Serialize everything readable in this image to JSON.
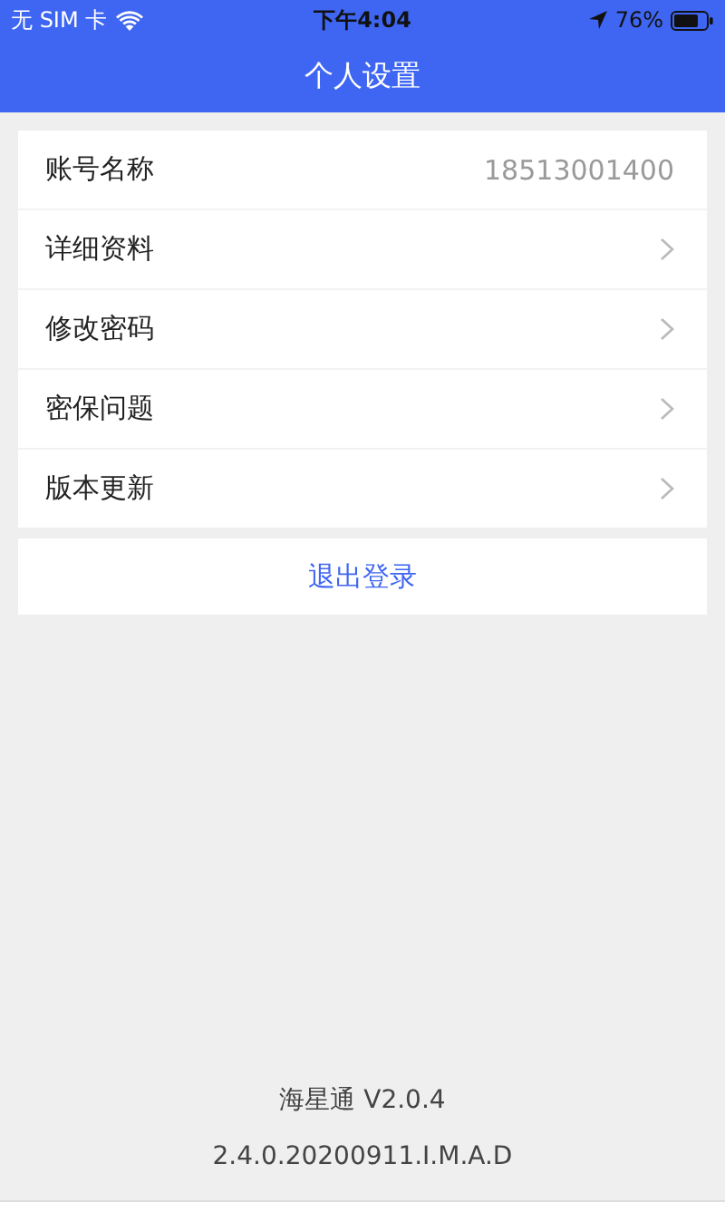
{
  "status_bar": {
    "carrier": "无 SIM 卡",
    "time": "下午4:04",
    "battery": "76%"
  },
  "nav_bar": {
    "title": "个人设置"
  },
  "settings": [
    {
      "kind": "value",
      "label": "账号名称",
      "value": "18513001400"
    },
    {
      "kind": "link",
      "label": "详细资料"
    },
    {
      "kind": "link",
      "label": "修改密码"
    },
    {
      "kind": "link",
      "label": "密保问题"
    },
    {
      "kind": "link",
      "label": "版本更新"
    }
  ],
  "logout_button": "退出登录",
  "footer": {
    "app_version": "海星通 V2.0.4",
    "build": "2.4.0.20200911.I.M.A.D"
  }
}
